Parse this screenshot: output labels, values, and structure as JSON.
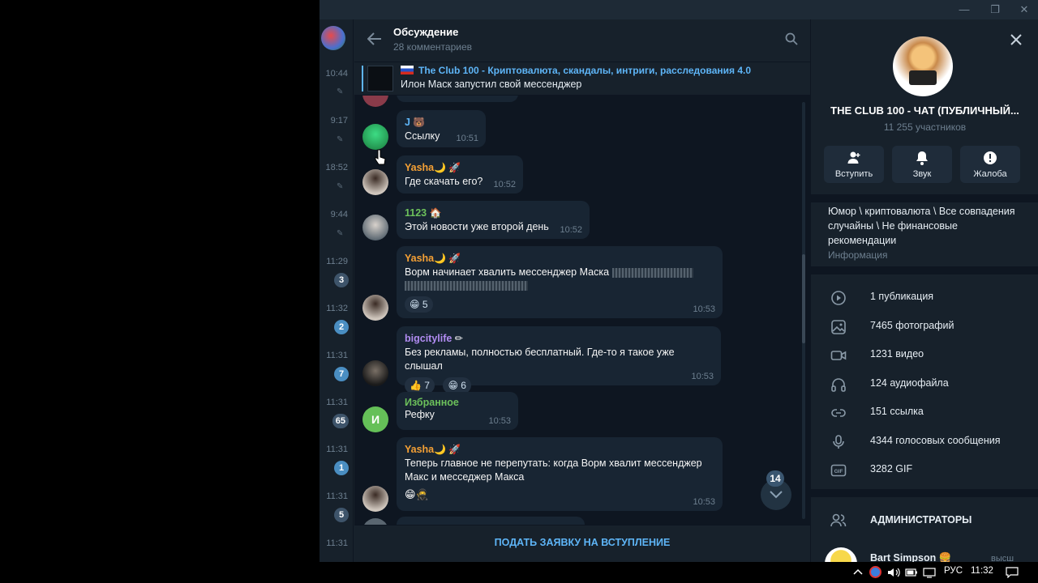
{
  "header": {
    "title": "Обсуждение",
    "subtitle": "28 комментариев"
  },
  "pinned": {
    "channel": "The Club 100 - Криптовалюта, скандалы, интриги, расследования 4.0",
    "text": "Илон Маск запустил свой мессенджер"
  },
  "chatlist": {
    "times": [
      "10:44",
      "9:17",
      "18:52",
      "9:44",
      "11:29",
      "11:32",
      "11:31",
      "11:31",
      "11:31",
      "11:31",
      "11:31"
    ],
    "badges": [
      "3",
      "2",
      "7",
      "65",
      "1",
      "5"
    ]
  },
  "messages": [
    {
      "sender": "J",
      "text": "Ссылку",
      "time": "10:51",
      "color": "#5eb5f7"
    },
    {
      "sender": "Yasha",
      "text": "Где скачать его?",
      "time": "10:52",
      "color": "#f4a035"
    },
    {
      "sender": "1123",
      "text": "Этой новости уже второй день",
      "time": "10:52",
      "color": "#6cc05b"
    },
    {
      "sender": "Yasha",
      "text": "Ворм начинает хвалить мессенджер Маска",
      "time": "10:53",
      "color": "#f4a035",
      "reaction_count": "5"
    },
    {
      "sender": "bigcitylife",
      "text": "Без рекламы, полностью бесплатный. Где-то я такое уже слышал",
      "time": "10:53",
      "color": "#b18cf2",
      "reactions": [
        "7",
        "6"
      ]
    },
    {
      "sender": "Избранное",
      "text": "Рефку",
      "time": "10:53",
      "color": "#6cc05b",
      "avatar_letter": "И"
    },
    {
      "sender": "Yasha",
      "text_line1": "Теперь главное не перепутать: когда Ворм хвалит мессенджер",
      "text_line2": "Макс и месседжер Макса",
      "time": "10:53",
      "color": "#f4a035"
    }
  ],
  "scroll_badge": "14",
  "footer": {
    "join_label": "ПОДАТЬ ЗАЯВКУ НА ВСТУПЛЕНИЕ"
  },
  "info": {
    "name": "THE CLUB 100 - ЧАТ (ПУБЛИЧНЫЙ...",
    "members": "11 255 участников",
    "actions": {
      "join": "Вступить",
      "sound": "Звук",
      "report": "Жалоба"
    },
    "description_lines": [
      "Юмор \\ криптовалюта \\ Все совпадения",
      "случайны \\ Не финансовые",
      "рекомендации"
    ],
    "description_label": "Информация",
    "media": [
      "1 публикация",
      "7465 фотографий",
      "1231 видео",
      "124 аудиофайла",
      "151 ссылка",
      "4344 голосовых сообщения",
      "3282 GIF"
    ],
    "admins_header": "АДМИНИСТРАТОРЫ",
    "admin_name": "Bart Simpson",
    "admin_role": "высш"
  },
  "taskbar": {
    "lang": "РУС",
    "clock": "11:32"
  },
  "colors": {
    "accent": "#5eb5f7",
    "panel": "#17212b",
    "chat_bg": "#0e1621",
    "bubble": "#182533"
  }
}
